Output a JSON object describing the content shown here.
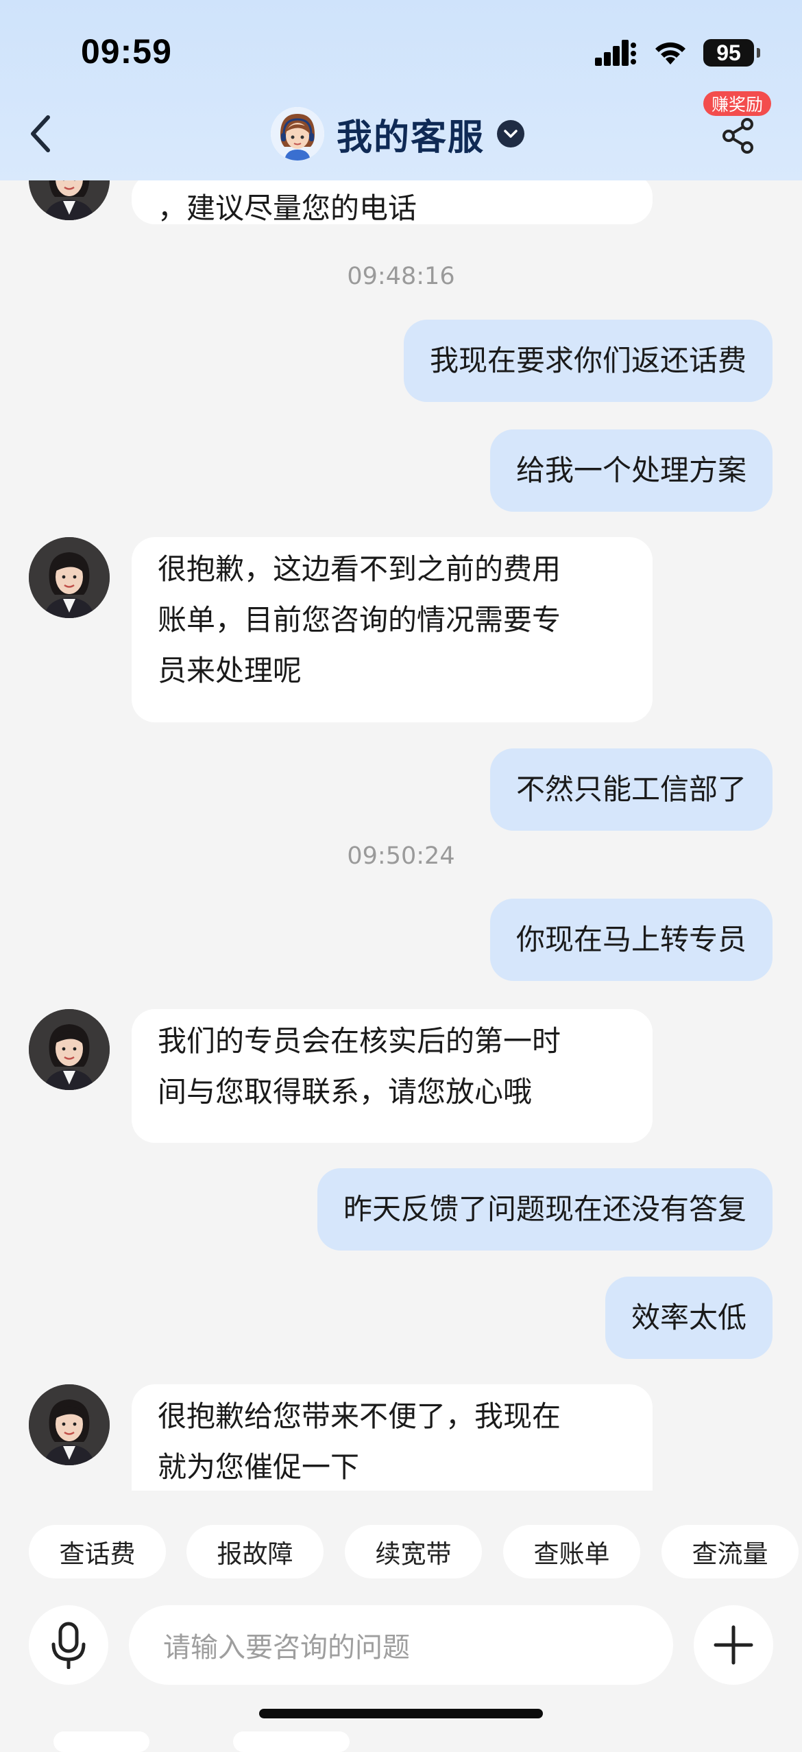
{
  "status_bar": {
    "time": "09:59",
    "battery": "95"
  },
  "header": {
    "title": "我的客服",
    "reward_badge": "赚奖励"
  },
  "chat": {
    "messages": [
      {
        "side": "in",
        "lines": [
          "，建议尽量您的电话"
        ]
      },
      {
        "type": "time",
        "text": "09:48:16"
      },
      {
        "side": "out",
        "text": "我现在要求你们返还话费"
      },
      {
        "side": "out",
        "text": "给我一个处理方案"
      },
      {
        "side": "in",
        "lines": [
          "很抱歉，这边看不到之前的费用",
          "账单，目前您咨询的情况需要专",
          "员来处理呢"
        ]
      },
      {
        "side": "out",
        "text": "不然只能工信部了"
      },
      {
        "type": "time",
        "text": "09:50:24"
      },
      {
        "side": "out",
        "text": "你现在马上转专员"
      },
      {
        "side": "in",
        "lines": [
          "我们的专员会在核实后的第一时",
          "间与您取得联系，请您放心哦"
        ]
      },
      {
        "side": "out",
        "text": "昨天反馈了问题现在还没有答复"
      },
      {
        "side": "out",
        "text": "效率太低"
      },
      {
        "side": "in",
        "lines": [
          "很抱歉给您带来不便了，我现在",
          "就为您催促一下"
        ]
      }
    ]
  },
  "quick_replies": [
    "查话费",
    "报故障",
    "续宽带",
    "查账单",
    "查流量"
  ],
  "input": {
    "placeholder": "请输入要咨询的问题"
  },
  "icons": {
    "back": "chevron-left-icon",
    "share": "share-icon",
    "mic": "microphone-icon",
    "plus": "plus-icon",
    "signal": "cellular-signal-icon",
    "wifi": "wifi-icon"
  }
}
